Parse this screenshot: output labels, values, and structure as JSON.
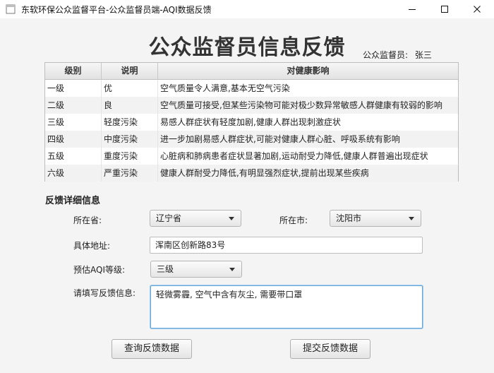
{
  "window": {
    "title": "东软环保公众监督平台-公众监督员端-AQI数据反馈"
  },
  "header": {
    "title": "公众监督员信息反馈",
    "supervisor_label": "公众监督员:",
    "supervisor_name": "张三"
  },
  "table": {
    "columns": [
      "级别",
      "说明",
      "对健康影响"
    ],
    "rows": [
      [
        "一级",
        "优",
        "空气质量令人满意,基本无空气污染"
      ],
      [
        "二级",
        "良",
        "空气质量可接受,但某些污染物可能对极少数异常敏感人群健康有较弱的影响"
      ],
      [
        "三级",
        "轻度污染",
        "易感人群症状有轻度加剧,健康人群出现刺激症状"
      ],
      [
        "四级",
        "中度污染",
        "进一步加剧易感人群症状,可能对健康人群心脏、呼吸系统有影响"
      ],
      [
        "五级",
        "重度污染",
        "心脏病和肺病患者症状显著加剧,运动耐受力降低,健康人群普遍出现症状"
      ],
      [
        "六级",
        "严重污染",
        "健康人群耐受力降低,有明显强烈症状,提前出现某些疾病"
      ]
    ]
  },
  "form": {
    "section_title": "反馈详细信息",
    "province_label": "所在省:",
    "province_value": "辽宁省",
    "city_label": "所在市:",
    "city_value": "沈阳市",
    "address_label": "具体地址:",
    "address_value": "浑南区创新路83号",
    "aqi_label": "预估AQI等级:",
    "aqi_value": "三级",
    "feedback_label": "请填写反馈信息:",
    "feedback_value": "轻微雾霾, 空气中含有灰尘, 需要带口罩"
  },
  "buttons": {
    "query": "查询反馈数据",
    "submit": "提交反馈数据"
  }
}
